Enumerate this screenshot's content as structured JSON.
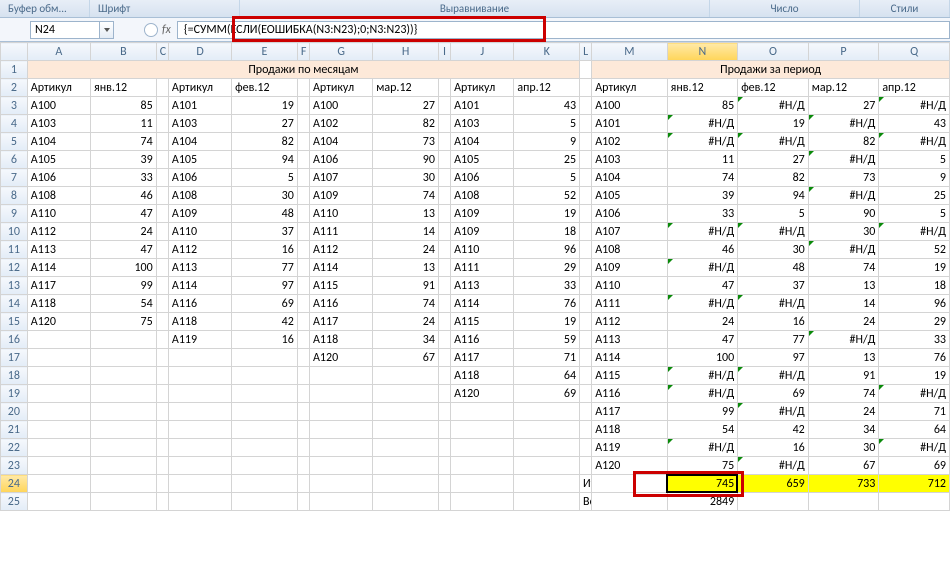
{
  "ribbon": {
    "r1": "Буфер обм...",
    "r2": "Шрифт",
    "r3": "Выравнивание",
    "r4": "Число",
    "r5": "Стили"
  },
  "namebox": "N24",
  "formula": "{=СУММ(ЕСЛИ(ЕОШИБКА(N3:N23);0;N3:N23))}",
  "titles": {
    "left": "Продажи по месяцам",
    "right": "Продажи за период"
  },
  "months": [
    "янв.12",
    "фев.12",
    "мар.12",
    "апр.12"
  ],
  "word_art": "Артикул",
  "cols": [
    "A",
    "B",
    "C",
    "D",
    "E",
    "F",
    "G",
    "H",
    "I",
    "J",
    "K",
    "L",
    "M",
    "N",
    "O",
    "P",
    "Q"
  ],
  "rows_count": 25,
  "err": "#Н/Д",
  "total_label": "Итого в месяц",
  "all_label": "Всего",
  "all_val": 2849,
  "totals": [
    745,
    659,
    733,
    712
  ],
  "block1": [
    [
      "A100",
      85
    ],
    [
      "A103",
      11
    ],
    [
      "A104",
      74
    ],
    [
      "A105",
      39
    ],
    [
      "A106",
      33
    ],
    [
      "A108",
      46
    ],
    [
      "A110",
      47
    ],
    [
      "A112",
      24
    ],
    [
      "A113",
      47
    ],
    [
      "A114",
      100
    ],
    [
      "A117",
      99
    ],
    [
      "A118",
      54
    ],
    [
      "A120",
      75
    ]
  ],
  "block2": [
    [
      "A101",
      19
    ],
    [
      "A103",
      27
    ],
    [
      "A104",
      82
    ],
    [
      "A105",
      94
    ],
    [
      "A106",
      5
    ],
    [
      "A108",
      30
    ],
    [
      "A109",
      48
    ],
    [
      "A110",
      37
    ],
    [
      "A112",
      16
    ],
    [
      "A113",
      77
    ],
    [
      "A114",
      97
    ],
    [
      "A116",
      69
    ],
    [
      "A118",
      42
    ],
    [
      "A119",
      16
    ]
  ],
  "block3": [
    [
      "A100",
      27
    ],
    [
      "A102",
      82
    ],
    [
      "A104",
      73
    ],
    [
      "A106",
      90
    ],
    [
      "A107",
      30
    ],
    [
      "A109",
      74
    ],
    [
      "A110",
      13
    ],
    [
      "A111",
      14
    ],
    [
      "A112",
      24
    ],
    [
      "A114",
      13
    ],
    [
      "A115",
      91
    ],
    [
      "A116",
      74
    ],
    [
      "A117",
      24
    ],
    [
      "A118",
      34
    ],
    [
      "A120",
      67
    ]
  ],
  "block4": [
    [
      "A101",
      43
    ],
    [
      "A103",
      5
    ],
    [
      "A104",
      9
    ],
    [
      "A105",
      25
    ],
    [
      "A106",
      5
    ],
    [
      "A108",
      52
    ],
    [
      "A109",
      19
    ],
    [
      "A109",
      18
    ],
    [
      "A110",
      96
    ],
    [
      "A111",
      29
    ],
    [
      "A113",
      33
    ],
    [
      "A114",
      76
    ],
    [
      "A115",
      19
    ],
    [
      "A116",
      59
    ],
    [
      "A117",
      71
    ],
    [
      "A118",
      64
    ],
    [
      "A120",
      69
    ]
  ],
  "right_block": {
    "arts": [
      "A100",
      "A101",
      "A102",
      "A103",
      "A104",
      "A105",
      "A106",
      "A107",
      "A108",
      "A109",
      "A110",
      "A111",
      "A112",
      "A113",
      "A114",
      "A115",
      "A116",
      "A117",
      "A118",
      "A119",
      "A120"
    ],
    "N": [
      85,
      "#Н/Д",
      "#Н/Д",
      11,
      74,
      39,
      33,
      "#Н/Д",
      46,
      "#Н/Д",
      47,
      "#Н/Д",
      24,
      47,
      100,
      "#Н/Д",
      "#Н/Д",
      99,
      54,
      "#Н/Д",
      75
    ],
    "O": [
      "#Н/Д",
      19,
      "#Н/Д",
      27,
      82,
      94,
      5,
      "#Н/Д",
      30,
      48,
      37,
      "#Н/Д",
      16,
      77,
      97,
      "#Н/Д",
      69,
      "#Н/Д",
      42,
      16,
      "#Н/Д"
    ],
    "P": [
      27,
      "#Н/Д",
      82,
      "#Н/Д",
      73,
      "#Н/Д",
      90,
      30,
      "#Н/Д",
      74,
      13,
      14,
      24,
      "#Н/Д",
      13,
      91,
      74,
      24,
      34,
      30,
      67
    ],
    "Q": [
      "#Н/Д",
      43,
      "#Н/Д",
      5,
      9,
      25,
      5,
      "#Н/Д",
      52,
      19,
      18,
      96,
      29,
      33,
      76,
      19,
      "#Н/Д",
      71,
      64,
      "#Н/Д",
      69
    ]
  }
}
